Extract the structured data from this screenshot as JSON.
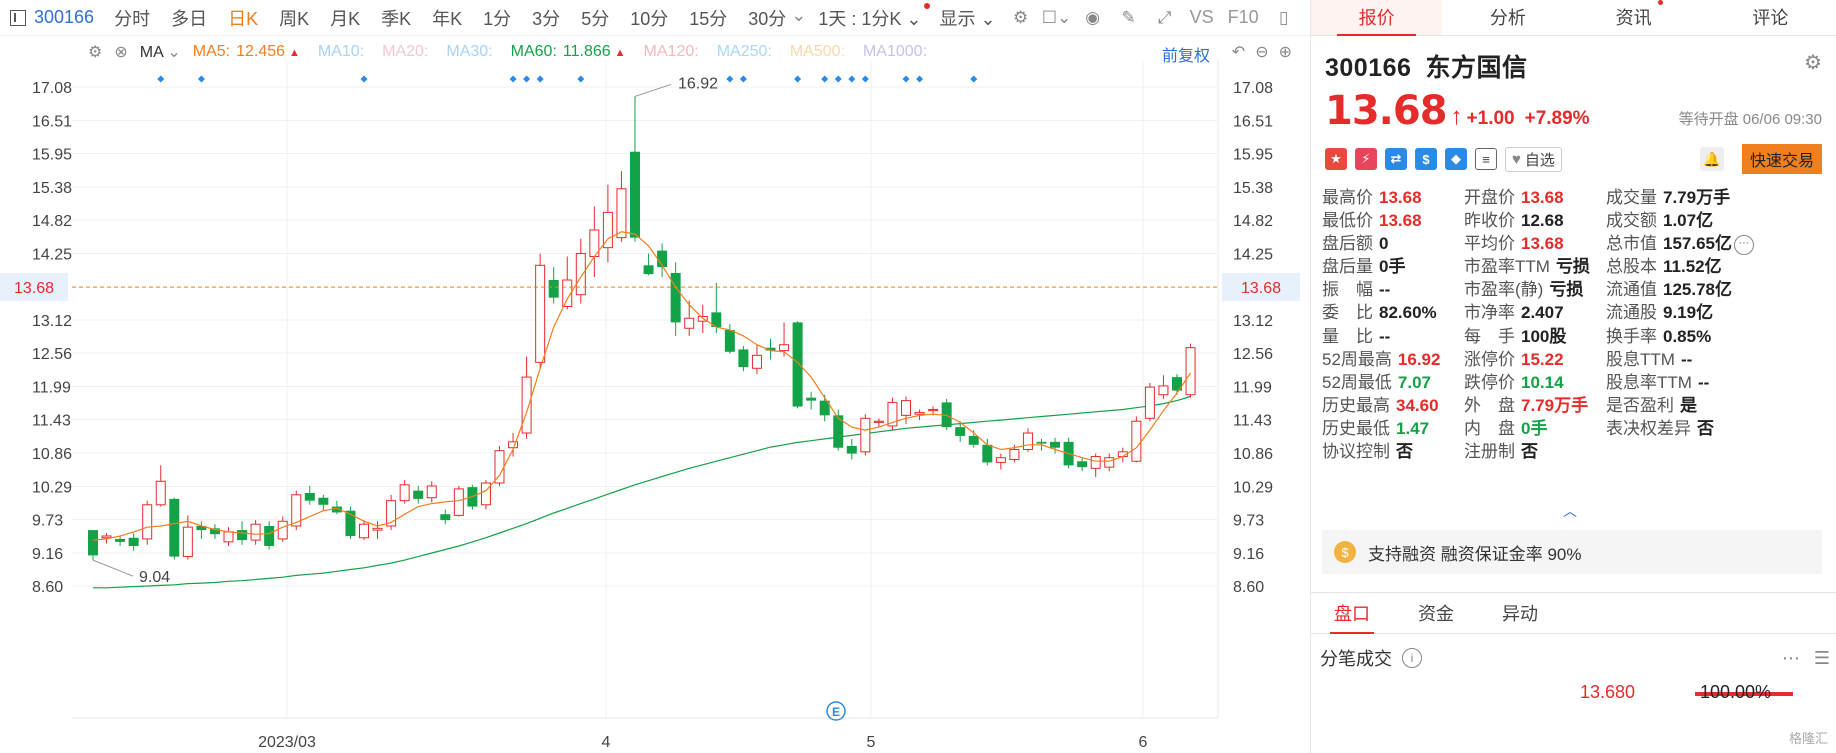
{
  "toolbar": {
    "ticker": "300166",
    "periods": [
      {
        "label": "分时",
        "active": false
      },
      {
        "label": "多日",
        "active": false
      },
      {
        "label": "日K",
        "active": true
      },
      {
        "label": "周K",
        "active": false
      },
      {
        "label": "月K",
        "active": false
      },
      {
        "label": "季K",
        "active": false
      },
      {
        "label": "年K",
        "active": false
      },
      {
        "label": "1分",
        "active": false
      },
      {
        "label": "3分",
        "active": false
      },
      {
        "label": "5分",
        "active": false
      },
      {
        "label": "10分",
        "active": false
      },
      {
        "label": "15分",
        "active": false
      },
      {
        "label": "30分",
        "active": false
      }
    ],
    "minute_select": "1天 : 1分K",
    "display_label": "显示",
    "vs_label": "VS",
    "f10_label": "F10"
  },
  "ma_legend": {
    "ma_select": "MA",
    "items": [
      {
        "label": "MA5:",
        "value": "12.456",
        "arrow": "▲",
        "color": "#f07f1e",
        "dim": false
      },
      {
        "label": "MA10:",
        "value": "",
        "arrow": "",
        "color": "#a9d2f5",
        "dim": true
      },
      {
        "label": "MA20:",
        "value": "",
        "arrow": "",
        "color": "#f5c6d6",
        "dim": true
      },
      {
        "label": "MA30:",
        "value": "",
        "arrow": "",
        "color": "#a9d2f5",
        "dim": true
      },
      {
        "label": "MA60:",
        "value": "11.866",
        "arrow": "▲",
        "color": "#13a247",
        "dim": false
      },
      {
        "label": "MA120:",
        "value": "",
        "arrow": "",
        "color": "#f5b8b8",
        "dim": true
      },
      {
        "label": "MA250:",
        "value": "",
        "arrow": "",
        "color": "#a9d8f5",
        "dim": true
      },
      {
        "label": "MA500:",
        "value": "",
        "arrow": "",
        "color": "#f7d9a8",
        "dim": true
      },
      {
        "label": "MA1000:",
        "value": "",
        "arrow": "",
        "color": "#c8c0ef",
        "dim": true
      }
    ],
    "adjust": "前复权"
  },
  "chart_data": {
    "type": "candlestick",
    "y_ticks": [
      "17.08",
      "16.51",
      "15.95",
      "15.38",
      "14.82",
      "14.25",
      "13.68",
      "13.12",
      "12.56",
      "11.99",
      "11.43",
      "10.86",
      "10.29",
      "9.73",
      "9.16",
      "8.60"
    ],
    "x_labels": [
      "2023/03",
      "4",
      "5",
      "6"
    ],
    "current_price": "13.68",
    "max_label": "16.92",
    "min_label": "9.04",
    "candles": [
      [
        9.55,
        9.12,
        9.55,
        9.04
      ],
      [
        9.42,
        9.45,
        9.5,
        9.32
      ],
      [
        9.4,
        9.35,
        9.45,
        9.28
      ],
      [
        9.42,
        9.28,
        9.5,
        9.2
      ],
      [
        9.4,
        9.98,
        10.05,
        9.3
      ],
      [
        9.98,
        10.38,
        10.65,
        9.95
      ],
      [
        10.08,
        9.1,
        10.1,
        9.05
      ],
      [
        9.1,
        9.6,
        9.8,
        9.05
      ],
      [
        9.62,
        9.55,
        9.7,
        9.4
      ],
      [
        9.58,
        9.48,
        9.65,
        9.4
      ],
      [
        9.35,
        9.52,
        9.6,
        9.28
      ],
      [
        9.55,
        9.38,
        9.7,
        9.3
      ],
      [
        9.38,
        9.65,
        9.72,
        9.3
      ],
      [
        9.62,
        9.28,
        9.7,
        9.22
      ],
      [
        9.4,
        9.7,
        9.78,
        9.35
      ],
      [
        9.62,
        10.15,
        10.22,
        9.55
      ],
      [
        10.18,
        10.05,
        10.3,
        9.98
      ],
      [
        10.1,
        9.98,
        10.15,
        9.88
      ],
      [
        9.95,
        9.85,
        10.05,
        9.82
      ],
      [
        9.88,
        9.45,
        9.95,
        9.4
      ],
      [
        9.42,
        9.65,
        9.72,
        9.38
      ],
      [
        9.55,
        9.58,
        9.7,
        9.4
      ],
      [
        9.62,
        10.05,
        10.15,
        9.55
      ],
      [
        10.05,
        10.32,
        10.4,
        10.0
      ],
      [
        10.22,
        10.08,
        10.3,
        10.0
      ],
      [
        10.1,
        10.3,
        10.38,
        10.02
      ],
      [
        9.82,
        9.72,
        9.9,
        9.65
      ],
      [
        9.8,
        10.25,
        10.3,
        9.78
      ],
      [
        10.28,
        9.95,
        10.32,
        9.9
      ],
      [
        9.98,
        10.35,
        10.4,
        9.9
      ],
      [
        10.35,
        10.9,
        10.98,
        10.3
      ],
      [
        10.95,
        11.05,
        11.2,
        10.8
      ],
      [
        11.2,
        12.15,
        12.5,
        11.1
      ],
      [
        12.4,
        14.05,
        14.25,
        12.3
      ],
      [
        13.8,
        13.5,
        14.02,
        13.4
      ],
      [
        13.35,
        13.8,
        14.2,
        13.3
      ],
      [
        13.55,
        14.25,
        14.5,
        13.4
      ],
      [
        14.2,
        14.65,
        15.05,
        13.85
      ],
      [
        14.35,
        14.95,
        15.42,
        14.1
      ],
      [
        14.52,
        15.35,
        15.65,
        14.45
      ],
      [
        15.98,
        14.52,
        16.92,
        14.45
      ],
      [
        14.05,
        13.9,
        14.25,
        13.88
      ],
      [
        14.3,
        14.02,
        14.42,
        13.85
      ],
      [
        13.92,
        13.08,
        14.1,
        12.85
      ],
      [
        12.98,
        13.15,
        13.45,
        12.85
      ],
      [
        13.1,
        13.18,
        13.38,
        12.9
      ],
      [
        13.25,
        13.0,
        13.75,
        12.9
      ],
      [
        12.95,
        12.58,
        13.05,
        12.55
      ],
      [
        12.62,
        12.32,
        12.68,
        12.25
      ],
      [
        12.3,
        12.52,
        12.7,
        12.2
      ],
      [
        12.65,
        12.6,
        12.8,
        12.45
      ],
      [
        12.6,
        12.7,
        13.08,
        12.5
      ],
      [
        13.08,
        11.65,
        13.1,
        11.62
      ],
      [
        11.8,
        11.75,
        11.9,
        11.6
      ],
      [
        11.75,
        11.5,
        11.85,
        11.4
      ],
      [
        11.5,
        10.95,
        11.6,
        10.9
      ],
      [
        10.98,
        10.85,
        11.1,
        10.75
      ],
      [
        10.88,
        11.45,
        11.52,
        10.82
      ],
      [
        11.38,
        11.4,
        11.45,
        11.3
      ],
      [
        11.32,
        11.72,
        11.8,
        11.25
      ],
      [
        11.5,
        11.75,
        11.82,
        11.35
      ],
      [
        11.52,
        11.55,
        11.6,
        11.42
      ],
      [
        11.58,
        11.6,
        11.65,
        11.5
      ],
      [
        11.72,
        11.3,
        11.78,
        11.25
      ],
      [
        11.3,
        11.15,
        11.4,
        11.05
      ],
      [
        11.15,
        11.0,
        11.25,
        10.95
      ],
      [
        11.0,
        10.7,
        11.1,
        10.65
      ],
      [
        10.7,
        10.78,
        10.85,
        10.58
      ],
      [
        10.75,
        10.92,
        11.0,
        10.7
      ],
      [
        10.92,
        11.2,
        11.28,
        10.88
      ],
      [
        11.05,
        11.02,
        11.1,
        10.9
      ],
      [
        11.05,
        10.95,
        11.12,
        10.85
      ],
      [
        11.05,
        10.65,
        11.12,
        10.6
      ],
      [
        10.72,
        10.62,
        10.78,
        10.55
      ],
      [
        10.6,
        10.8,
        10.85,
        10.45
      ],
      [
        10.62,
        10.78,
        10.85,
        10.55
      ],
      [
        10.8,
        10.88,
        10.95,
        10.7
      ],
      [
        10.72,
        11.4,
        11.48,
        10.7
      ],
      [
        11.45,
        11.98,
        12.05,
        11.4
      ],
      [
        11.85,
        12.0,
        12.18,
        11.78
      ],
      [
        12.15,
        11.92,
        12.2,
        11.85
      ],
      [
        11.85,
        12.65,
        12.72,
        11.8
      ]
    ],
    "ma5": [
      9.38,
      9.4,
      9.45,
      9.52,
      9.6,
      9.62,
      9.66,
      9.7,
      9.62,
      9.56,
      9.52,
      9.5,
      9.48,
      9.49,
      9.6,
      9.68,
      9.78,
      9.88,
      9.92,
      9.82,
      9.7,
      9.62,
      9.68,
      9.82,
      9.95,
      10.0,
      10.03,
      10.05,
      10.12,
      10.22,
      10.48,
      10.92,
      11.55,
      12.3,
      13.0,
      13.48,
      13.85,
      14.2,
      14.5,
      14.62,
      14.58,
      14.38,
      14.05,
      13.68,
      13.38,
      13.15,
      13.0,
      12.95,
      12.85,
      12.7,
      12.6,
      12.58,
      12.4,
      12.15,
      11.8,
      11.45,
      11.3,
      11.25,
      11.3,
      11.38,
      11.45,
      11.5,
      11.52,
      11.5,
      11.38,
      11.2,
      11.0,
      10.92,
      10.95,
      11.0,
      11.0,
      10.92,
      10.85,
      10.78,
      10.72,
      10.72,
      10.8,
      10.95,
      11.25,
      11.58,
      11.88,
      12.22
    ],
    "ma60": [
      8.57,
      8.57,
      8.58,
      8.59,
      8.6,
      8.61,
      8.62,
      8.64,
      8.65,
      8.66,
      8.68,
      8.69,
      8.71,
      8.73,
      8.75,
      8.78,
      8.8,
      8.82,
      8.85,
      8.88,
      8.91,
      8.95,
      8.99,
      9.04,
      9.1,
      9.16,
      9.22,
      9.28,
      9.35,
      9.42,
      9.5,
      9.58,
      9.66,
      9.75,
      9.84,
      9.92,
      10.0,
      10.08,
      10.16,
      10.24,
      10.32,
      10.39,
      10.46,
      10.53,
      10.6,
      10.66,
      10.72,
      10.78,
      10.84,
      10.9,
      10.96,
      11.0,
      11.04,
      11.07,
      11.1,
      11.13,
      11.16,
      11.19,
      11.22,
      11.25,
      11.28,
      11.3,
      11.32,
      11.34,
      11.36,
      11.38,
      11.4,
      11.42,
      11.44,
      11.46,
      11.48,
      11.5,
      11.52,
      11.54,
      11.56,
      11.58,
      11.6,
      11.63,
      11.66,
      11.7,
      11.75,
      11.82
    ],
    "markers": [
      5,
      8,
      20,
      31,
      32,
      33,
      36,
      47,
      48,
      52,
      54,
      55,
      56,
      57,
      60,
      61,
      65
    ]
  },
  "panel": {
    "tabs": [
      {
        "label": "报价",
        "active": true,
        "dot": false
      },
      {
        "label": "分析",
        "active": false,
        "dot": false
      },
      {
        "label": "资讯",
        "active": false,
        "dot": true
      },
      {
        "label": "评论",
        "active": false,
        "dot": false
      }
    ],
    "code": "300166",
    "name": "东方国信",
    "price": "13.68",
    "change": "+1.00",
    "change_pct": "+7.89%",
    "status": "等待开盘 06/06 09:30",
    "watchlist_label": "自选",
    "quick_trade_label": "快速交易",
    "badges": [
      {
        "icon": "flag-icon",
        "glyph": "★",
        "color": "#e84a3d"
      },
      {
        "icon": "lightning-icon",
        "glyph": "⚡",
        "color": "#e8455c"
      },
      {
        "icon": "shuffle-icon",
        "glyph": "⇄",
        "color": "#2b8ae6"
      },
      {
        "icon": "dollar-icon",
        "glyph": "$",
        "color": "#2b8ae6"
      },
      {
        "icon": "tag-icon",
        "glyph": "◆",
        "color": "#2b8ae6"
      },
      {
        "icon": "document-icon",
        "glyph": "≡",
        "color": "#ffffff"
      }
    ],
    "stats": [
      [
        {
          "label": "最高价",
          "value": "13.68",
          "color": "red"
        },
        {
          "label": "最低价",
          "value": "13.68",
          "color": "red"
        },
        {
          "label": "盘后额",
          "value": "0",
          "color": ""
        },
        {
          "label": "盘后量",
          "value": "0手",
          "color": ""
        },
        {
          "label": "振　幅",
          "value": "--",
          "color": ""
        },
        {
          "label": "委　比",
          "value": "82.60%",
          "color": ""
        },
        {
          "label": "量　比",
          "value": "--",
          "color": ""
        },
        {
          "label": "52周最高",
          "value": "16.92",
          "color": "red"
        },
        {
          "label": "52周最低",
          "value": "7.07",
          "color": "green"
        },
        {
          "label": "历史最高",
          "value": "34.60",
          "color": "red"
        },
        {
          "label": "历史最低",
          "value": "1.47",
          "color": "green"
        },
        {
          "label": "协议控制",
          "value": "否",
          "color": ""
        }
      ],
      [
        {
          "label": "开盘价",
          "value": "13.68",
          "color": "red"
        },
        {
          "label": "昨收价",
          "value": "12.68",
          "color": ""
        },
        {
          "label": "平均价",
          "value": "13.68",
          "color": "red"
        },
        {
          "label": "市盈率TTM",
          "value": "亏损",
          "color": ""
        },
        {
          "label": "市盈率(静)",
          "value": "亏损",
          "color": ""
        },
        {
          "label": "市净率",
          "value": "2.407",
          "color": ""
        },
        {
          "label": "每　手",
          "value": "100股",
          "color": ""
        },
        {
          "label": "涨停价",
          "value": "15.22",
          "color": "red"
        },
        {
          "label": "跌停价",
          "value": "10.14",
          "color": "green"
        },
        {
          "label": "外　盘",
          "value": "7.79万手",
          "color": "red"
        },
        {
          "label": "内　盘",
          "value": "0手",
          "color": "green"
        },
        {
          "label": "注册制",
          "value": "否",
          "color": ""
        }
      ],
      [
        {
          "label": "成交量",
          "value": "7.79万手",
          "color": ""
        },
        {
          "label": "成交额",
          "value": "1.07亿",
          "color": ""
        },
        {
          "label": "总市值",
          "value": "157.65亿",
          "color": ""
        },
        {
          "label": "总股本",
          "value": "11.52亿",
          "color": ""
        },
        {
          "label": "流通值",
          "value": "125.78亿",
          "color": ""
        },
        {
          "label": "流通股",
          "value": "9.19亿",
          "color": ""
        },
        {
          "label": "换手率",
          "value": "0.85%",
          "color": ""
        },
        {
          "label": "股息TTM",
          "value": "--",
          "color": ""
        },
        {
          "label": "股息率TTM",
          "value": "--",
          "color": ""
        },
        {
          "label": "是否盈利",
          "value": "是",
          "color": ""
        },
        {
          "label": "表决权差异",
          "value": "否",
          "color": ""
        }
      ]
    ],
    "margin_text": "支持融资 融资保证金率 90%",
    "sub_tabs": [
      {
        "label": "盘口",
        "active": true
      },
      {
        "label": "资金",
        "active": false
      },
      {
        "label": "异动",
        "active": false
      }
    ],
    "tick_title": "分笔成交",
    "tick_price": "13.680",
    "tick_pct": "100.00%",
    "tick_fill": 1.0,
    "watermark": "格隆汇"
  }
}
